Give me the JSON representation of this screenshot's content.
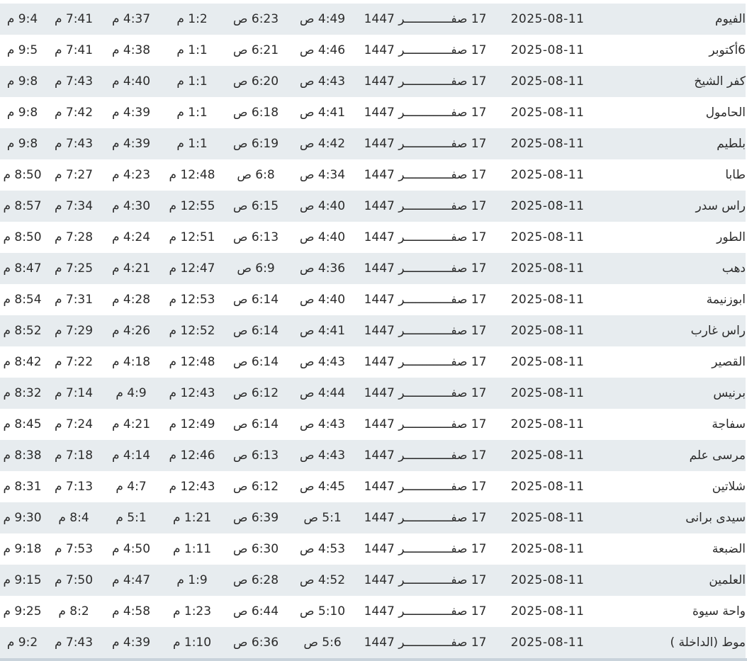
{
  "rows": [
    {
      "city": "الفيوم",
      "date": "2025-08-11",
      "hijri": "17 صفـــــــــــــر 1447",
      "fajr": "4:49 ص",
      "sunrise": "6:23 ص",
      "dhuhr": "1:2 م",
      "asr": "4:37 م",
      "maghrib": "7:41 م",
      "isha": "9:4 م"
    },
    {
      "city": "6أكتوبر",
      "date": "2025-08-11",
      "hijri": "17 صفـــــــــــــر 1447",
      "fajr": "4:46 ص",
      "sunrise": "6:21 ص",
      "dhuhr": "1:1 م",
      "asr": "4:38 م",
      "maghrib": "7:41 م",
      "isha": "9:5 م"
    },
    {
      "city": "كفر الشيخ",
      "date": "2025-08-11",
      "hijri": "17 صفـــــــــــــر 1447",
      "fajr": "4:43 ص",
      "sunrise": "6:20 ص",
      "dhuhr": "1:1 م",
      "asr": "4:40 م",
      "maghrib": "7:43 م",
      "isha": "9:8 م"
    },
    {
      "city": "الحامول",
      "date": "2025-08-11",
      "hijri": "17 صفـــــــــــــر 1447",
      "fajr": "4:41 ص",
      "sunrise": "6:18 ص",
      "dhuhr": "1:1 م",
      "asr": "4:39 م",
      "maghrib": "7:42 م",
      "isha": "9:8 م"
    },
    {
      "city": "بلطيم",
      "date": "2025-08-11",
      "hijri": "17 صفـــــــــــــر 1447",
      "fajr": "4:42 ص",
      "sunrise": "6:19 ص",
      "dhuhr": "1:1 م",
      "asr": "4:39 م",
      "maghrib": "7:43 م",
      "isha": "9:8 م"
    },
    {
      "city": "طابا",
      "date": "2025-08-11",
      "hijri": "17 صفـــــــــــــر 1447",
      "fajr": "4:34 ص",
      "sunrise": "6:8 ص",
      "dhuhr": "12:48 م",
      "asr": "4:23 م",
      "maghrib": "7:27 م",
      "isha": "8:50 م"
    },
    {
      "city": "راس سدر",
      "date": "2025-08-11",
      "hijri": "17 صفـــــــــــــر 1447",
      "fajr": "4:40 ص",
      "sunrise": "6:15 ص",
      "dhuhr": "12:55 م",
      "asr": "4:30 م",
      "maghrib": "7:34 م",
      "isha": "8:57 م"
    },
    {
      "city": "الطور",
      "date": "2025-08-11",
      "hijri": "17 صفـــــــــــــر 1447",
      "fajr": "4:40 ص",
      "sunrise": "6:13 ص",
      "dhuhr": "12:51 م",
      "asr": "4:24 م",
      "maghrib": "7:28 م",
      "isha": "8:50 م"
    },
    {
      "city": "دهب",
      "date": "2025-08-11",
      "hijri": "17 صفـــــــــــــر 1447",
      "fajr": "4:36 ص",
      "sunrise": "6:9 ص",
      "dhuhr": "12:47 م",
      "asr": "4:21 م",
      "maghrib": "7:25 م",
      "isha": "8:47 م"
    },
    {
      "city": "ابوزنيمة",
      "date": "2025-08-11",
      "hijri": "17 صفـــــــــــــر 1447",
      "fajr": "4:40 ص",
      "sunrise": "6:14 ص",
      "dhuhr": "12:53 م",
      "asr": "4:28 م",
      "maghrib": "7:31 م",
      "isha": "8:54 م"
    },
    {
      "city": "راس غارب",
      "date": "2025-08-11",
      "hijri": "17 صفـــــــــــــر 1447",
      "fajr": "4:41 ص",
      "sunrise": "6:14 ص",
      "dhuhr": "12:52 م",
      "asr": "4:26 م",
      "maghrib": "7:29 م",
      "isha": "8:52 م"
    },
    {
      "city": "القصير",
      "date": "2025-08-11",
      "hijri": "17 صفـــــــــــــر 1447",
      "fajr": "4:43 ص",
      "sunrise": "6:14 ص",
      "dhuhr": "12:48 م",
      "asr": "4:18 م",
      "maghrib": "7:22 م",
      "isha": "8:42 م"
    },
    {
      "city": "برنيس",
      "date": "2025-08-11",
      "hijri": "17 صفـــــــــــــر 1447",
      "fajr": "4:44 ص",
      "sunrise": "6:12 ص",
      "dhuhr": "12:43 م",
      "asr": "4:9 م",
      "maghrib": "7:14 م",
      "isha": "8:32 م"
    },
    {
      "city": "سفاجة",
      "date": "2025-08-11",
      "hijri": "17 صفـــــــــــــر 1447",
      "fajr": "4:43 ص",
      "sunrise": "6:14 ص",
      "dhuhr": "12:49 م",
      "asr": "4:21 م",
      "maghrib": "7:24 م",
      "isha": "8:45 م"
    },
    {
      "city": "مرسى علم",
      "date": "2025-08-11",
      "hijri": "17 صفـــــــــــــر 1447",
      "fajr": "4:43 ص",
      "sunrise": "6:13 ص",
      "dhuhr": "12:46 م",
      "asr": "4:14 م",
      "maghrib": "7:18 م",
      "isha": "8:38 م"
    },
    {
      "city": "شلاتين",
      "date": "2025-08-11",
      "hijri": "17 صفـــــــــــــر 1447",
      "fajr": "4:45 ص",
      "sunrise": "6:12 ص",
      "dhuhr": "12:43 م",
      "asr": "4:7 م",
      "maghrib": "7:13 م",
      "isha": "8:31 م"
    },
    {
      "city": "سيدى برانى",
      "date": "2025-08-11",
      "hijri": "17 صفـــــــــــــر 1447",
      "fajr": "5:1 ص",
      "sunrise": "6:39 ص",
      "dhuhr": "1:21 م",
      "asr": "5:1 م",
      "maghrib": "8:4 م",
      "isha": "9:30 م"
    },
    {
      "city": "الضبعة",
      "date": "2025-08-11",
      "hijri": "17 صفـــــــــــــر 1447",
      "fajr": "4:53 ص",
      "sunrise": "6:30 ص",
      "dhuhr": "1:11 م",
      "asr": "4:50 م",
      "maghrib": "7:53 م",
      "isha": "9:18 م"
    },
    {
      "city": "العلمين",
      "date": "2025-08-11",
      "hijri": "17 صفـــــــــــــر 1447",
      "fajr": "4:52 ص",
      "sunrise": "6:28 ص",
      "dhuhr": "1:9 م",
      "asr": "4:47 م",
      "maghrib": "7:50 م",
      "isha": "9:15 م"
    },
    {
      "city": "واحة سيوة",
      "date": "2025-08-11",
      "hijri": "17 صفـــــــــــــر 1447",
      "fajr": "5:10 ص",
      "sunrise": "6:44 ص",
      "dhuhr": "1:23 م",
      "asr": "4:58 م",
      "maghrib": "8:2 م",
      "isha": "9:25 م"
    },
    {
      "city": "موط (الداخلة )",
      "date": "2025-08-11",
      "hijri": "17 صفـــــــــــــر 1447",
      "fajr": "5:6 ص",
      "sunrise": "6:36 ص",
      "dhuhr": "1:10 م",
      "asr": "4:39 م",
      "maghrib": "7:43 م",
      "isha": "9:2 م"
    }
  ]
}
